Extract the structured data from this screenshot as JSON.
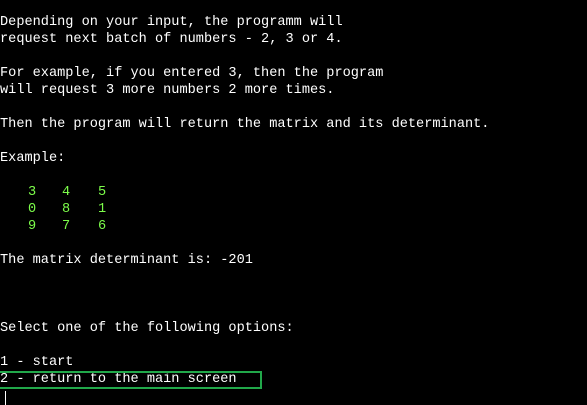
{
  "terminal": {
    "intro": [
      "Depending on your input, the programm will",
      "request next batch of numbers - 2, 3 or 4.",
      "For example, if you entered 3, then the program",
      "will request 3 more numbers 2 more times.",
      "Then the program will return the matrix and its determinant.",
      "Example:"
    ],
    "matrix": [
      [
        "3",
        "4",
        "5"
      ],
      [
        "0",
        "8",
        "1"
      ],
      [
        "9",
        "7",
        "6"
      ]
    ],
    "determinant_line": "The matrix determinant is: -201",
    "divider": "================================================================================",
    "prompt": "Select one of the following options:",
    "options": [
      "1 - start",
      "2 - return to the main screen"
    ],
    "selected_option_index": 1,
    "colors": {
      "background": "#000000",
      "text": "#ffffff",
      "matrix": "#7cfc4a",
      "selection": "#21a84a"
    }
  }
}
